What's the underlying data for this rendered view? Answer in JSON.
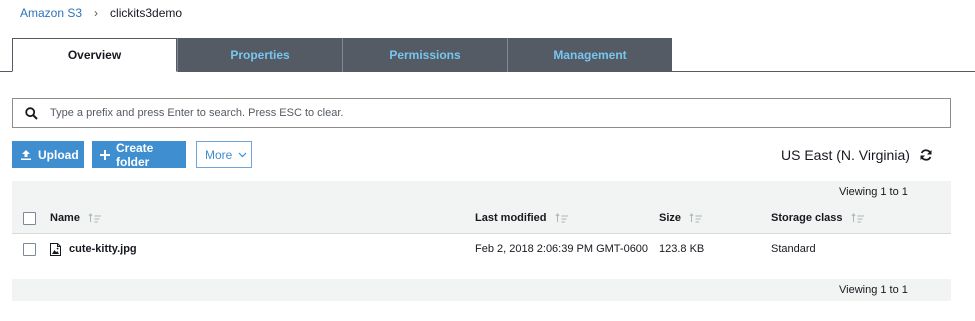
{
  "breadcrumb": {
    "root": "Amazon S3",
    "separator": "›",
    "current": "clickits3demo"
  },
  "tabs": [
    {
      "label": "Overview",
      "active": true
    },
    {
      "label": "Properties",
      "active": false
    },
    {
      "label": "Permissions",
      "active": false
    },
    {
      "label": "Management",
      "active": false
    }
  ],
  "search": {
    "placeholder": "Type a prefix and press Enter to search. Press ESC to clear.",
    "value": ""
  },
  "toolbar": {
    "upload_label": "Upload",
    "create_folder_label": "Create folder",
    "more_label": "More",
    "region": "US East (N. Virginia)"
  },
  "viewing": {
    "top": "Viewing 1 to 1",
    "bottom": "Viewing 1 to 1"
  },
  "table": {
    "columns": [
      "Name",
      "Last modified",
      "Size",
      "Storage class"
    ],
    "rows": [
      {
        "name": "cute-kitty.jpg",
        "last_modified": "Feb 2, 2018 2:06:39 PM GMT-0600",
        "size": "123.8 KB",
        "storage_class": "Standard"
      }
    ]
  },
  "colors": {
    "accent": "#3f8ed0",
    "tab_inactive_bg": "#545b64",
    "tab_inactive_text": "#78c6f0",
    "link": "#2e73b8"
  },
  "icons": [
    "upload-icon",
    "plus-icon",
    "chevron-down-icon",
    "search-icon",
    "refresh-icon",
    "sort-icon",
    "image-file-icon"
  ]
}
